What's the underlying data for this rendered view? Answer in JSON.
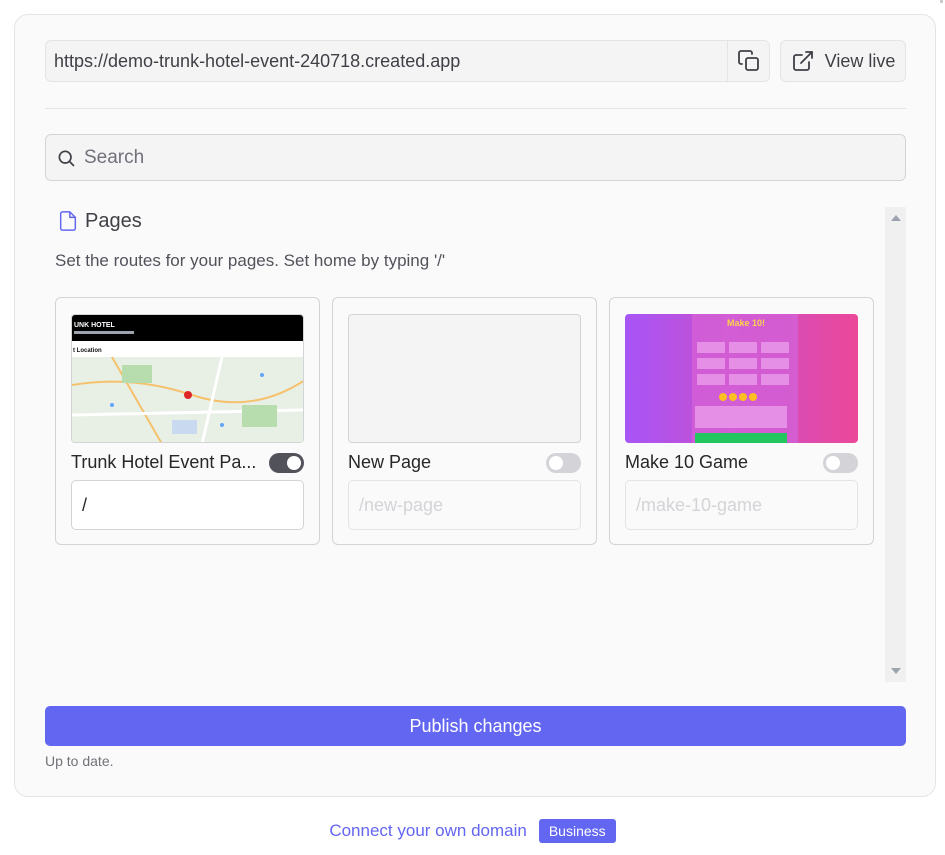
{
  "header": {
    "url": "https://demo-trunk-hotel-event-240718.created.app",
    "view_live_label": "View live"
  },
  "search": {
    "placeholder": "Search"
  },
  "pages_section": {
    "title": "Pages",
    "description": "Set the routes for your pages. Set home by typing '/'"
  },
  "pages": [
    {
      "name": "Trunk Hotel Event Pa...",
      "route": "/",
      "placeholder": "",
      "enabled": true,
      "thumb_header": "UNK HOTEL",
      "thumb_label": "t Location"
    },
    {
      "name": "New Page",
      "route": "",
      "placeholder": "/new-page",
      "enabled": false
    },
    {
      "name": "Make 10 Game",
      "route": "",
      "placeholder": "/make-10-game",
      "enabled": false,
      "thumb_title": "Make 10!"
    }
  ],
  "publish": {
    "label": "Publish changes",
    "status": "Up to date."
  },
  "footer": {
    "link_label": "Connect your own domain",
    "badge_label": "Business"
  },
  "colors": {
    "accent": "#6366f1",
    "toggle_on": "#52525b",
    "toggle_off": "#d4d4d8"
  }
}
